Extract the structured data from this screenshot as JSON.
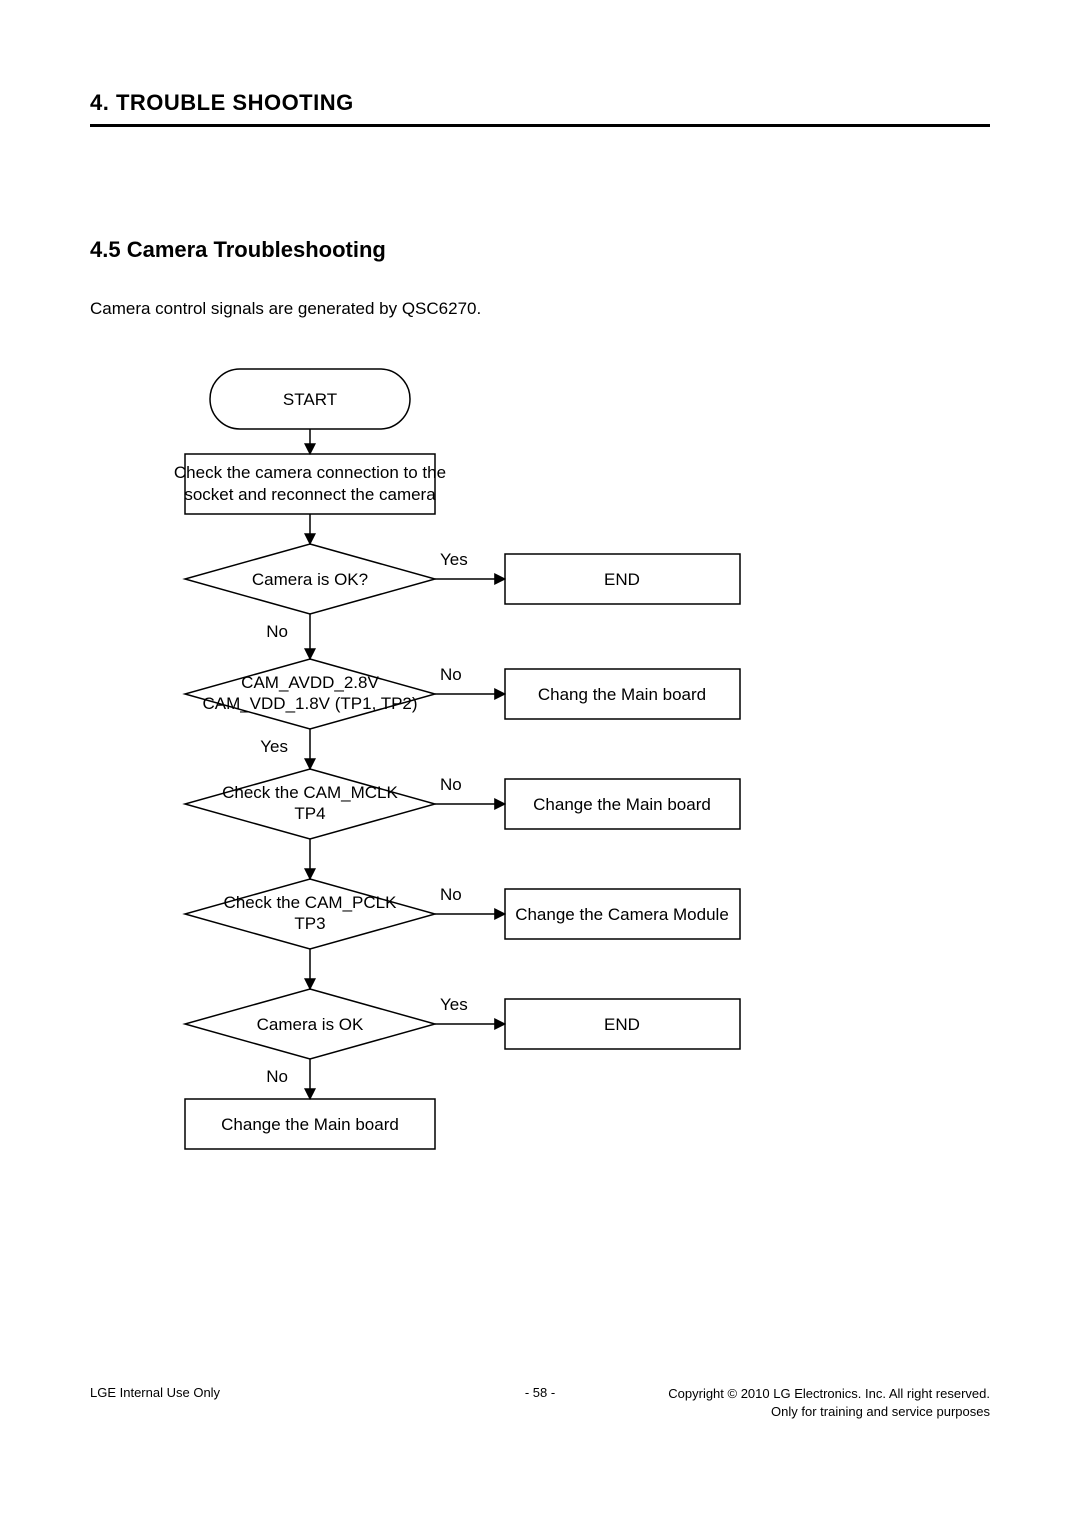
{
  "header": {
    "chapter": "4. TROUBLE SHOOTING",
    "section": "4.5  Camera Troubleshooting",
    "intro": "Camera control signals are generated by QSC6270."
  },
  "flow": {
    "start": "START",
    "step_check_conn_l1": "Check the camera connection to the",
    "step_check_conn_l2": "socket and reconnect the camera",
    "dec_camera_ok_q": "Camera is OK?",
    "dec_avdd_l1": "CAM_AVDD_2.8V",
    "dec_avdd_l2": "CAM_VDD_1.8V (TP1, TP2)",
    "dec_mclk_l1": "Check the CAM_MCLK",
    "dec_mclk_l2": "TP4",
    "dec_pclk_l1": "Check the CAM_PCLK",
    "dec_pclk_l2": "TP3",
    "dec_camera_ok": "Camera is OK",
    "act_end": "END",
    "act_chang_main": "Chang the Main board",
    "act_change_main": "Change the Main board",
    "act_change_cam_module": "Change the Camera Module",
    "label_yes": "Yes",
    "label_no": "No"
  },
  "footer": {
    "left": "LGE Internal Use Only",
    "center": "- 58 -",
    "right1": "Copyright © 2010 LG Electronics. Inc. All right reserved.",
    "right2": "Only for training and service purposes"
  }
}
